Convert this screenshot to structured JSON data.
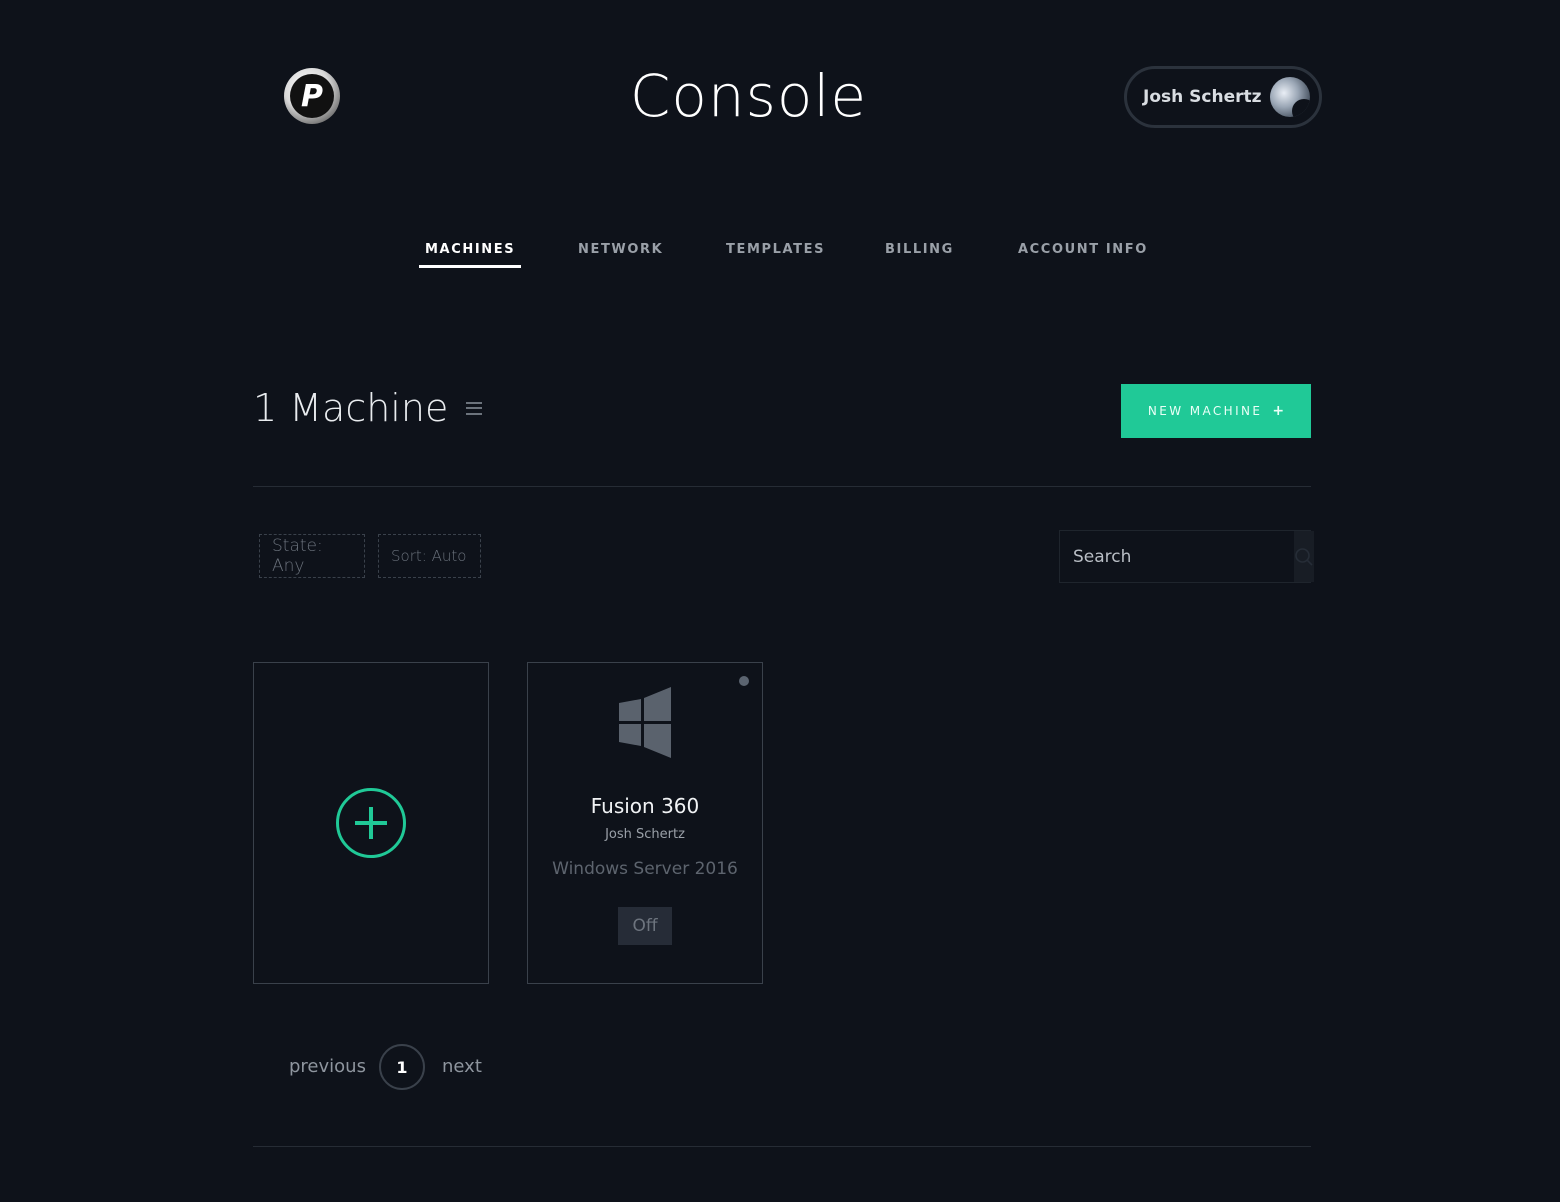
{
  "header": {
    "logo_letter": "P",
    "title": "Console",
    "user_name": "Josh Schertz"
  },
  "nav": {
    "tabs": [
      {
        "label": "MACHINES",
        "active": true
      },
      {
        "label": "NETWORK",
        "active": false
      },
      {
        "label": "TEMPLATES",
        "active": false
      },
      {
        "label": "BILLING",
        "active": false
      },
      {
        "label": "ACCOUNT INFO",
        "active": false
      }
    ]
  },
  "main": {
    "count_label": "1 Machine",
    "new_machine_label": "NEW MACHINE",
    "new_machine_icon": "+",
    "filters": {
      "state": "State: Any",
      "sort": "Sort: Auto"
    },
    "search": {
      "placeholder": "Search"
    },
    "machines": [
      {
        "name": "Fusion 360",
        "owner": "Josh Schertz",
        "os": "Windows Server 2016",
        "state": "Off",
        "os_icon": "windows-icon"
      }
    ]
  },
  "pagination": {
    "previous": "previous",
    "current": "1",
    "next": "next"
  },
  "colors": {
    "background": "#0e121a",
    "accent": "#20c997",
    "border": "#3a414b",
    "muted_text": "#9aa0a8"
  }
}
